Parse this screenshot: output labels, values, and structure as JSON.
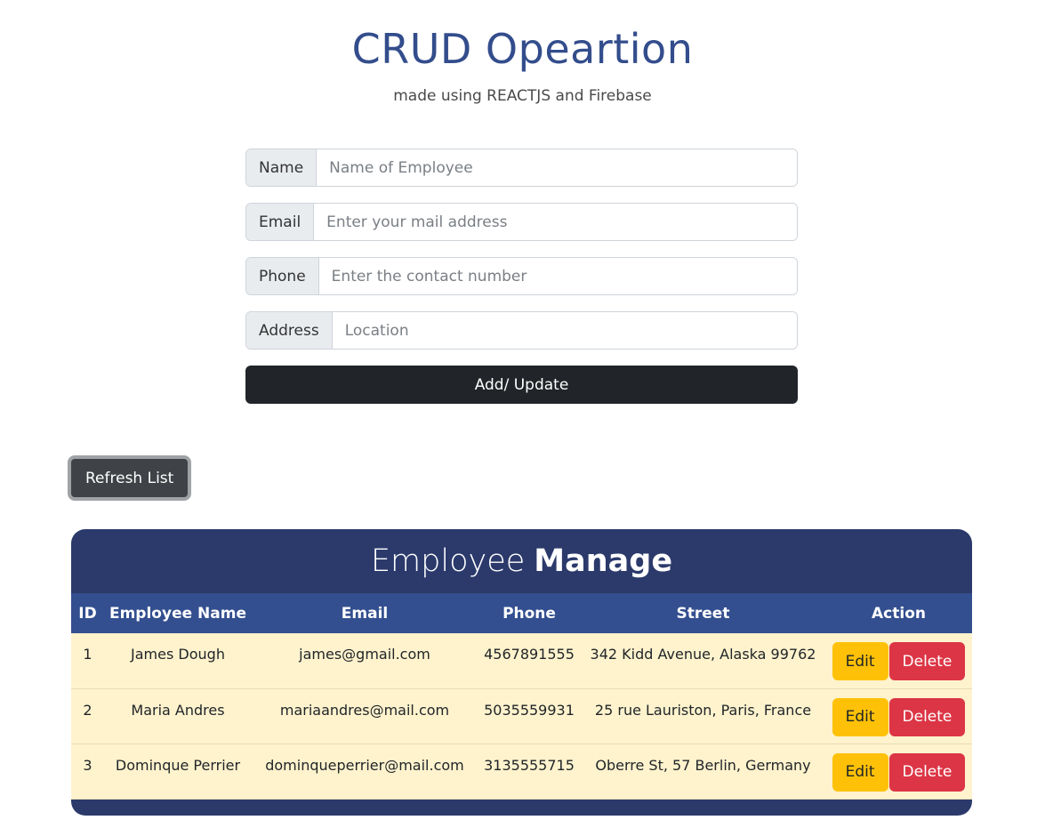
{
  "header": {
    "title": "CRUD Opeartion",
    "subtitle": "made using REACTJS and Firebase"
  },
  "form": {
    "fields": [
      {
        "label": "Name",
        "placeholder": "Name of Employee",
        "value": ""
      },
      {
        "label": "Email",
        "placeholder": "Enter your mail address",
        "value": ""
      },
      {
        "label": "Phone",
        "placeholder": "Enter the contact number",
        "value": ""
      },
      {
        "label": "Address",
        "placeholder": "Location",
        "value": ""
      }
    ],
    "submit_label": "Add/ Update"
  },
  "refresh_label": "Refresh List",
  "table": {
    "heading_light": "Employee",
    "heading_bold": "Manage",
    "columns": [
      "ID",
      "Employee Name",
      "Email",
      "Phone",
      "Street",
      "Action"
    ],
    "rows": [
      {
        "id": "1",
        "name": "James Dough",
        "email": "james@gmail.com",
        "phone": "4567891555",
        "street": "342 Kidd Avenue, Alaska 99762"
      },
      {
        "id": "2",
        "name": "Maria Andres",
        "email": "mariaandres@mail.com",
        "phone": "5035559931",
        "street": "25 rue Lauriston, Paris, France"
      },
      {
        "id": "3",
        "name": "Dominque Perrier",
        "email": "dominqueperrier@mail.com",
        "phone": "3135555715",
        "street": "Oberre St, 57 Berlin, Germany"
      }
    ],
    "edit_label": "Edit",
    "delete_label": "Delete"
  },
  "colors": {
    "title": "#334d8c",
    "table_header_bg": "#2b3a6b",
    "column_header_bg": "#334f8f",
    "row_bg": "#fff3cd",
    "edit_button": "#ffc107",
    "delete_button": "#dc3545",
    "submit_button": "#212529"
  }
}
